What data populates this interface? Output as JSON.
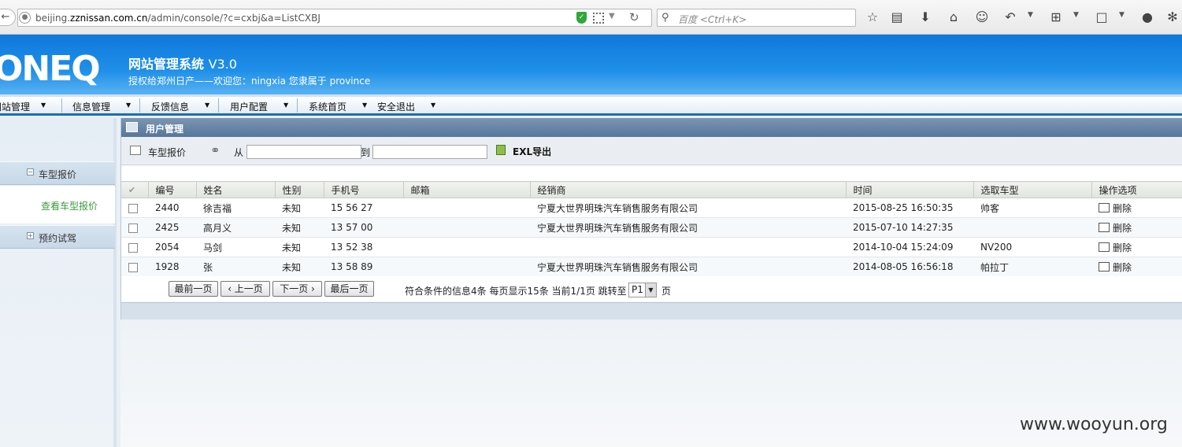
{
  "browser": {
    "url_prefix": "beijing.",
    "url_domain": "zznissan.com.cn",
    "url_path": "/admin/console/?c=cxbj&a=ListCXBJ",
    "search_placeholder": "百度 <Ctrl+K>"
  },
  "header": {
    "logo": "ONEQ",
    "title": "网站管理系统",
    "version": "V3.0",
    "subtitle": "授权给郑州日产——欢迎您：ningxia 您隶属于 province"
  },
  "menu": [
    {
      "label": "网站管理"
    },
    {
      "label": "信息管理"
    },
    {
      "label": "反馈信息"
    },
    {
      "label": "用户配置"
    },
    {
      "label": "系统首页"
    },
    {
      "label": "安全退出"
    }
  ],
  "sidebar": {
    "group1": "车型报价",
    "group1_item": "查看车型报价",
    "group2": "预约试驾"
  },
  "panel": {
    "title": "用户管理",
    "tool_label": "车型报价",
    "from_label": "从",
    "to_label": "到",
    "export_label": "EXL导出"
  },
  "table": {
    "headers": [
      "编号",
      "姓名",
      "性别",
      "手机号",
      "邮箱",
      "经销商",
      "时间",
      "选取车型",
      "操作选项"
    ],
    "rows": [
      {
        "id": "2440",
        "name": "徐吉福",
        "gender": "未知",
        "phone": "15  56  27",
        "email": "",
        "dealer": "宁夏大世界明珠汽车销售服务有限公司",
        "time": "2015-08-25 16:50:35",
        "model": "帅客",
        "action": "删除"
      },
      {
        "id": "2425",
        "name": "高月义",
        "gender": "未知",
        "phone": "13  57  00",
        "email": "",
        "dealer": "宁夏大世界明珠汽车销售服务有限公司",
        "time": "2015-07-10 14:27:35",
        "model": "",
        "action": "删除"
      },
      {
        "id": "2054",
        "name": "马剑",
        "gender": "未知",
        "phone": "13  52  38",
        "email": "",
        "dealer": "",
        "time": "2014-10-04 15:24:09",
        "model": "NV200",
        "action": "删除"
      },
      {
        "id": "1928",
        "name": "张",
        "gender": "未知",
        "phone": "13  58  89",
        "email": "",
        "dealer": "宁夏大世界明珠汽车销售服务有限公司",
        "time": "2014-08-05 16:56:18",
        "model": "帕拉丁",
        "action": "删除"
      }
    ]
  },
  "pager": {
    "first": "最前一页",
    "prev": "‹ 上一页",
    "next": "下一页 ›",
    "last": "最后一页",
    "info": "符合条件的信息4条 每页显示15条 当前1/1页 跳转至",
    "select_value": "P1",
    "page_suffix": "页"
  },
  "watermark": "www.wooyun.org"
}
